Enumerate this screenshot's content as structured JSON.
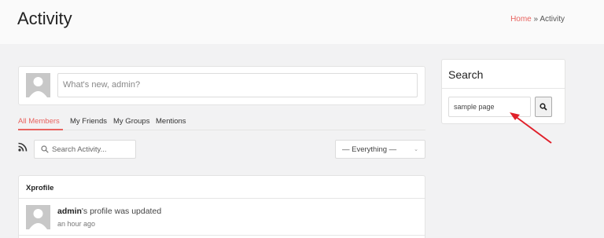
{
  "header": {
    "title": "Activity",
    "breadcrumb": {
      "home": "Home",
      "separator": " » ",
      "current": "Activity"
    }
  },
  "post_box": {
    "placeholder": "What's new, admin?"
  },
  "tabs": [
    {
      "label": "All Members",
      "active": true
    },
    {
      "label": "My Friends",
      "active": false
    },
    {
      "label": "My Groups",
      "active": false
    },
    {
      "label": "Mentions",
      "active": false
    }
  ],
  "activity_search": {
    "placeholder": "Search Activity..."
  },
  "filter": {
    "selected": "— Everything —"
  },
  "feed": {
    "title": "Xprofile",
    "item": {
      "user": "admin",
      "text": "'s profile was updated",
      "time": "an hour ago"
    }
  },
  "search_widget": {
    "title": "Search",
    "value": "sample page"
  },
  "icons": [
    "rss-icon",
    "search-icon",
    "chevron-down-icon",
    "avatar-placeholder"
  ],
  "colors": {
    "accent": "#e8635f",
    "annotation_arrow": "#e0202a"
  }
}
